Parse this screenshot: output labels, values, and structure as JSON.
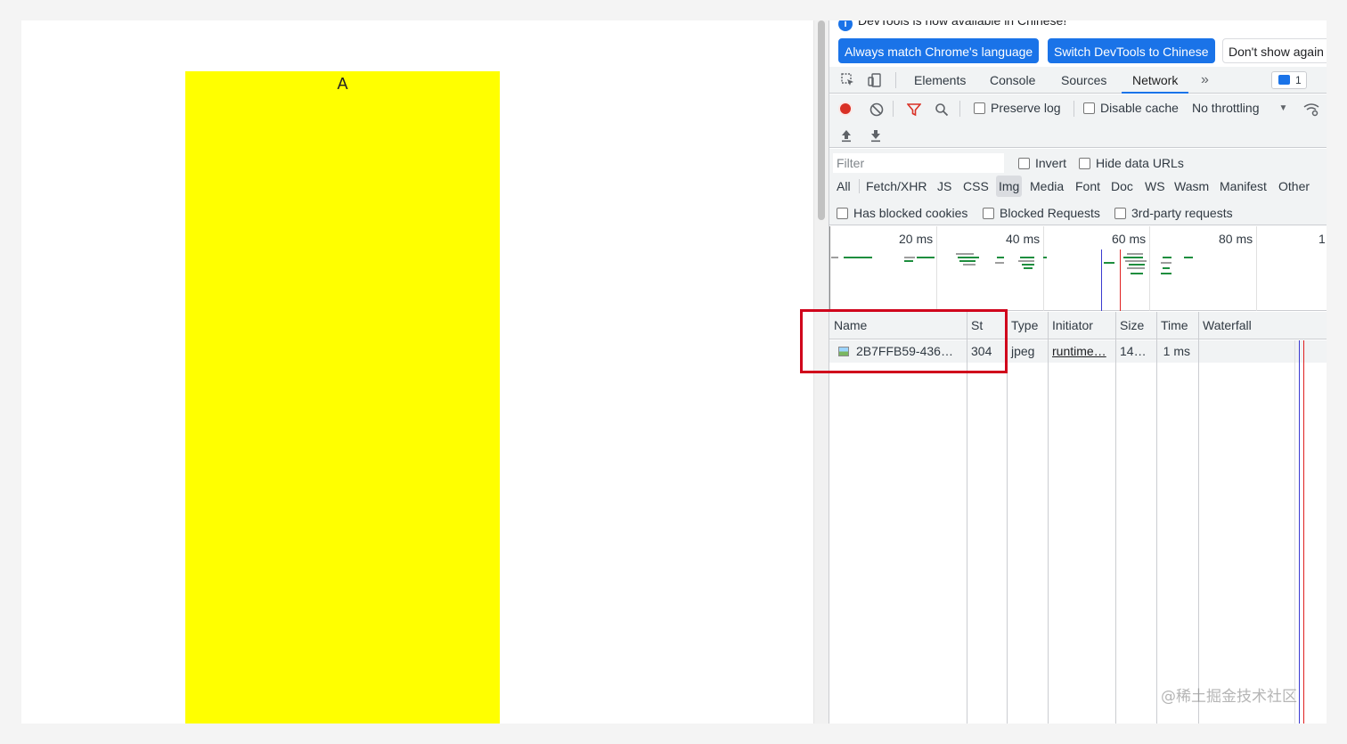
{
  "page": {
    "box_letter": "A",
    "box_color": "#ffff00"
  },
  "devtools": {
    "infobar": {
      "message": "DevTools is now available in Chinese!",
      "icon": "info-icon",
      "buttons": [
        "Always match Chrome's language",
        "Switch DevTools to Chinese",
        "Don't show again"
      ]
    },
    "tabs": {
      "items": [
        "Elements",
        "Console",
        "Sources",
        "Network"
      ],
      "active": "Network",
      "more": "»",
      "issues_count": "1"
    },
    "toolbar": {
      "preserve_log": "Preserve log",
      "disable_cache": "Disable cache",
      "throttling": "No throttling",
      "throttling_arrow": "▼"
    },
    "filter": {
      "placeholder": "Filter",
      "invert": "Invert",
      "hide_data_urls": "Hide data URLs",
      "types": [
        "All",
        "Fetch/XHR",
        "JS",
        "CSS",
        "Img",
        "Media",
        "Font",
        "Doc",
        "WS",
        "Wasm",
        "Manifest",
        "Other"
      ],
      "active_type": "Img",
      "has_blocked_cookies": "Has blocked cookies",
      "blocked_requests": "Blocked Requests",
      "third_party": "3rd-party requests"
    },
    "overview": {
      "ticks": [
        "20 ms",
        "40 ms",
        "60 ms",
        "80 ms",
        "1"
      ]
    },
    "table": {
      "columns": [
        "Name",
        "St",
        "Type",
        "Initiator",
        "Size",
        "Time",
        "Waterfall"
      ],
      "rows": [
        {
          "name": "2B7FFB59-436…",
          "status": "304",
          "type": "jpeg",
          "initiator": "runtime…",
          "size": "14…",
          "time": "1 ms"
        }
      ]
    }
  },
  "watermark": "@稀土掘金技术社区"
}
